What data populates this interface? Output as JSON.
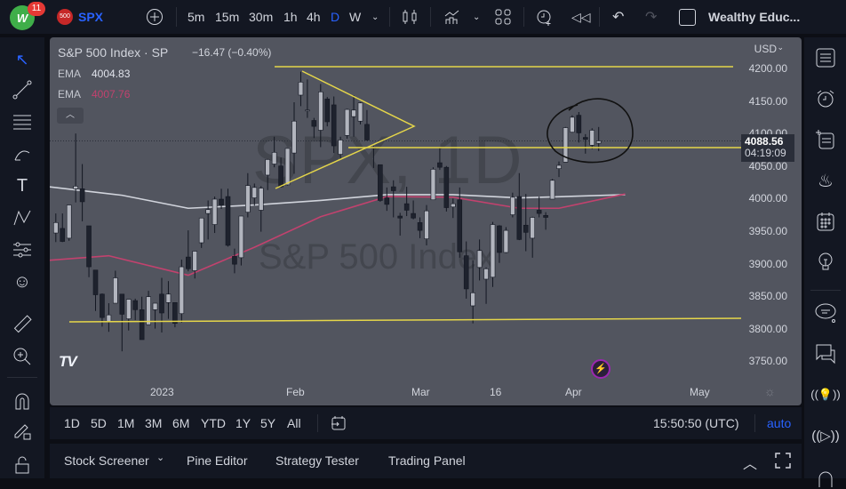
{
  "topbar": {
    "notif_count": "11",
    "symbol_badge": "500",
    "symbol": "SPX",
    "intervals": [
      "5m",
      "15m",
      "30m",
      "1h",
      "4h",
      "D",
      "W"
    ],
    "active_interval": "D",
    "layout_name": "Wealthy Educ..."
  },
  "legend": {
    "title": "S&P 500 Index · SP",
    "change": "−16.47 (−0.40%)",
    "ema1_label": "EMA",
    "ema1_value": "4004.83",
    "ema2_label": "EMA",
    "ema2_value": "4007.76"
  },
  "watermark": {
    "line1": "SPX, 1D",
    "line2": "S&P 500 Index"
  },
  "price_scale": {
    "currency": "USD",
    "ticks": [
      "4200.00",
      "4150.00",
      "4100.00",
      "4050.00",
      "4000.00",
      "3950.00",
      "3900.00",
      "3850.00",
      "3800.00",
      "3750.00"
    ],
    "last_price": "4088.56",
    "countdown": "04:19:09"
  },
  "time_scale": {
    "labels": [
      "2023",
      "Feb",
      "Mar",
      "16",
      "Apr",
      "May"
    ]
  },
  "range_bar": {
    "ranges": [
      "1D",
      "5D",
      "1M",
      "3M",
      "6M",
      "YTD",
      "1Y",
      "5Y",
      "All"
    ],
    "clock": "15:50:50 (UTC)",
    "scale_mode": "auto"
  },
  "bottom_tabs": [
    "Stock Screener",
    "Pine Editor",
    "Strategy Tester",
    "Trading Panel"
  ],
  "colors": {
    "accent": "#2962ff",
    "ema1": "#d1d4dc",
    "ema2": "#c2426e",
    "drawing": "#e5d64a",
    "up": "#b2b5be",
    "down": "#1e222d"
  },
  "chart_data": {
    "type": "candlestick",
    "ylim": [
      3725,
      4250
    ],
    "first_day": "2022-12-08",
    "ohlc": [
      [
        3947,
        3977,
        3933,
        3963
      ],
      [
        3954,
        3977,
        3933,
        3934
      ],
      [
        3939,
        3990,
        3935,
        3990
      ],
      [
        4015,
        4100,
        3994,
        4019
      ],
      [
        4015,
        4053,
        3965,
        3995
      ],
      [
        3958,
        3958,
        3879,
        3895
      ],
      [
        3890,
        3890,
        3827,
        3852
      ],
      [
        3853,
        3854,
        3803,
        3817
      ],
      [
        3810,
        3839,
        3795,
        3821
      ],
      [
        3839,
        3889,
        3839,
        3878
      ],
      [
        3853,
        3853,
        3765,
        3822
      ],
      [
        3815,
        3845,
        3797,
        3845
      ],
      [
        3843,
        3846,
        3813,
        3829
      ],
      [
        3829,
        3849,
        3783,
        3783
      ],
      [
        3806,
        3858,
        3806,
        3849
      ],
      [
        3829,
        3839,
        3800,
        3839
      ],
      [
        3853,
        3878,
        3794,
        3824
      ],
      [
        3840,
        3873,
        3815,
        3853
      ],
      [
        3840,
        3840,
        3802,
        3808
      ],
      [
        3823,
        3906,
        3809,
        3895
      ],
      [
        3910,
        3951,
        3888,
        3892
      ],
      [
        3889,
        3919,
        3877,
        3919
      ],
      [
        3932,
        3970,
        3924,
        3970
      ],
      [
        3977,
        3997,
        3937,
        3983
      ],
      [
        3960,
        4003,
        3947,
        3999
      ],
      [
        3999,
        4015,
        3984,
        3990
      ],
      [
        4003,
        4015,
        3926,
        3928
      ],
      [
        3911,
        3923,
        3885,
        3899
      ],
      [
        3909,
        3973,
        3897,
        3973
      ],
      [
        3979,
        4039,
        3971,
        4020
      ],
      [
        4001,
        4023,
        3989,
        4017
      ],
      [
        3982,
        4019,
        3949,
        4016
      ],
      [
        4036,
        4061,
        4013,
        4060
      ],
      [
        4053,
        4095,
        4048,
        4071
      ],
      [
        4050,
        4063,
        4017,
        4018
      ],
      [
        4021,
        4077,
        4020,
        4077
      ],
      [
        4070,
        4148,
        4038,
        4119
      ],
      [
        4159,
        4195,
        4142,
        4179
      ],
      [
        4136,
        4183,
        4124,
        4136
      ],
      [
        4120,
        4124,
        4093,
        4111
      ],
      [
        4105,
        4176,
        4079,
        4164
      ],
      [
        4153,
        4156,
        4111,
        4118
      ],
      [
        4144,
        4157,
        4070,
        4081
      ],
      [
        4068,
        4095,
        4060,
        4090
      ],
      [
        4097,
        4138,
        4092,
        4137
      ],
      [
        4126,
        4159,
        4095,
        4136
      ],
      [
        4119,
        4148,
        4114,
        4147
      ],
      [
        4114,
        4136,
        4089,
        4090
      ],
      [
        4077,
        4081,
        4047,
        4079
      ],
      [
        4052,
        4052,
        3995,
        3997
      ],
      [
        4001,
        4017,
        3981,
        3991
      ],
      [
        4018,
        4028,
        3971,
        4012
      ],
      [
        3973,
        3978,
        3943,
        3970
      ],
      [
        3992,
        4018,
        3973,
        3982
      ],
      [
        3977,
        3997,
        3968,
        3970
      ],
      [
        3963,
        3971,
        3939,
        3951
      ],
      [
        3938,
        3990,
        3928,
        3981
      ],
      [
        3998,
        4048,
        3998,
        4045
      ],
      [
        4055,
        4078,
        4044,
        4048
      ],
      [
        4048,
        4050,
        3980,
        3986
      ],
      [
        3987,
        4000,
        3970,
        3992
      ],
      [
        3998,
        4017,
        3909,
        3918
      ],
      [
        3912,
        3934,
        3846,
        3861
      ],
      [
        3835,
        3905,
        3808,
        3855
      ],
      [
        3894,
        3937,
        3874,
        3920
      ],
      [
        3876,
        3894,
        3838,
        3892
      ],
      [
        3879,
        3964,
        3864,
        3960
      ],
      [
        3958,
        3959,
        3901,
        3917
      ],
      [
        3917,
        3956,
        3916,
        3951
      ],
      [
        3975,
        4009,
        3971,
        4002
      ],
      [
        4003,
        4039,
        3936,
        3937
      ],
      [
        3959,
        4007,
        3919,
        3948
      ],
      [
        3939,
        3972,
        3909,
        3971
      ],
      [
        3982,
        4003,
        3971,
        3977
      ],
      [
        3974,
        3979,
        3952,
        3971
      ],
      [
        3999,
        4030,
        3999,
        4028
      ],
      [
        4046,
        4057,
        4033,
        4051
      ],
      [
        4056,
        4110,
        4056,
        4109
      ],
      [
        4102,
        4128,
        4101,
        4125
      ],
      [
        4128,
        4133,
        4086,
        4101
      ],
      [
        4094,
        4099,
        4069,
        4091
      ],
      [
        4082,
        4108,
        4076,
        4105
      ],
      [
        4085,
        4110,
        4073,
        4088.56
      ]
    ],
    "ema_long": [
      [
        -1,
        4018
      ],
      [
        10,
        4005
      ],
      [
        20,
        3985
      ],
      [
        30,
        3990
      ],
      [
        40,
        3997
      ],
      [
        50,
        4006
      ],
      [
        60,
        4006
      ],
      [
        70,
        4001
      ],
      [
        80,
        4004
      ],
      [
        86,
        4006
      ]
    ],
    "ema_short": [
      [
        -1,
        3905
      ],
      [
        8,
        3912
      ],
      [
        20,
        3882
      ],
      [
        30,
        3925
      ],
      [
        40,
        3972
      ],
      [
        50,
        4003
      ],
      [
        60,
        4002
      ],
      [
        70,
        3985
      ],
      [
        76,
        3985
      ],
      [
        86,
        4007
      ]
    ]
  }
}
